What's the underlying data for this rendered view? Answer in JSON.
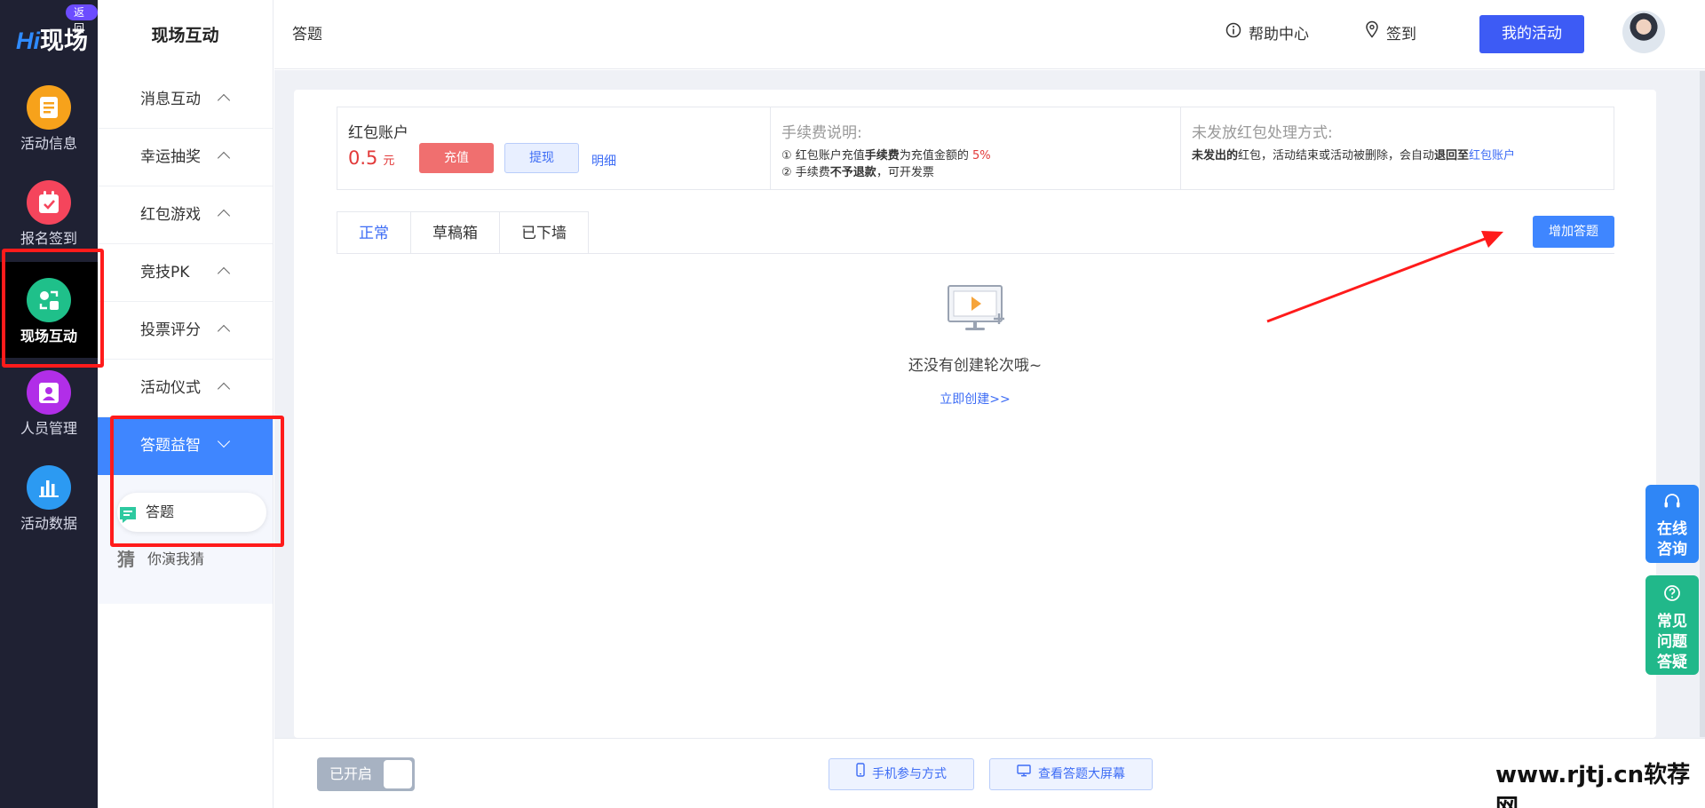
{
  "rail": {
    "logo_hi": "Hi",
    "logo_text": "现场",
    "back_badge": "返回",
    "items": [
      {
        "label": "活动信息",
        "icon": "document-icon",
        "color": "#f7a21b"
      },
      {
        "label": "报名签到",
        "icon": "calendar-check-icon",
        "color": "#f5455c"
      },
      {
        "label": "现场互动",
        "icon": "interaction-icon",
        "color": "#1fc08a"
      },
      {
        "label": "人员管理",
        "icon": "contact-card-icon",
        "color": "#b12ee8"
      },
      {
        "label": "活动数据",
        "icon": "bar-chart-icon",
        "color": "#2c9af2"
      }
    ]
  },
  "subnav": {
    "title": "现场互动",
    "groups": [
      "消息互动",
      "幸运抽奖",
      "红包游戏",
      "竞技PK",
      "投票评分",
      "活动仪式",
      "答题益智"
    ],
    "subitems": [
      {
        "label": "答题",
        "icon": "quiz-chat-icon"
      },
      {
        "label": "你演我猜",
        "icon_glyph": "猜"
      }
    ]
  },
  "header": {
    "breadcrumb": "答题",
    "help": "帮助中心",
    "checkin": "签到",
    "my_activity": "我的活动"
  },
  "account": {
    "title": "红包账户",
    "amount": "0.5",
    "unit": "元",
    "recharge": "充值",
    "withdraw": "提现",
    "detail": "明细"
  },
  "fee": {
    "title": "手续费说明:",
    "line1_prefix": "① 红包账户充值",
    "line1_bold": "手续费",
    "line1_mid": "为充值金额的",
    "line1_rate": "5%",
    "line2_prefix": "② 手续费",
    "line2_bold": "不予退款",
    "line2_suffix": "，可开发票"
  },
  "unsent": {
    "title": "未发放红包处理方式:",
    "bold1": "未发出的",
    "text1": "红包，活动结束或活动被删除，会自动",
    "bold2": "退回至",
    "link": "红包账户"
  },
  "tabs": [
    "正常",
    "草稿箱",
    "已下墙"
  ],
  "add_button": "增加答题",
  "empty": {
    "message": "还没有创建轮次哦~",
    "create_link": "立即创建>>"
  },
  "footer": {
    "toggle_label": "已开启",
    "mobile_join": "手机参与方式",
    "view_screen": "查看答题大屏幕",
    "watermark": "www.rjtj.cn软荐网"
  },
  "floats": {
    "online": [
      "在线",
      "咨询"
    ],
    "faq": [
      "常见",
      "问题",
      "答疑"
    ]
  },
  "colors": {
    "primary": "#3d5bf5",
    "accent_blue": "#3f86ff",
    "danger": "#e23a3a",
    "annotation": "#ff1b1b"
  }
}
